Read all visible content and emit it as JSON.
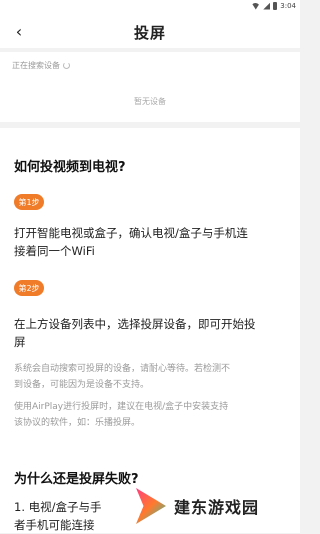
{
  "status_bar": {
    "time": "3:04"
  },
  "header": {
    "title": "投屏",
    "back_icon": "chevron-left-icon"
  },
  "devices": {
    "searching_label": "正在搜索设备",
    "empty_label": "暂无设备"
  },
  "guide": {
    "heading": "如何投视频到电视?",
    "step1_badge": "第1步",
    "step1_text_line1": "打开智能电视或盒子，确认电视/盒子与手机连",
    "step1_text_line2": "接着同一个WiFi",
    "step2_badge": "第2步",
    "step2_text_line1": "在上方设备列表中，选择投屏设备，即可开始投",
    "step2_text_line2": "屏",
    "note1_line1": "系统会自动搜索可投屏的设备，请耐心等待。若检测不",
    "note1_line2": "到设备，可能因为是设备不支持。",
    "note2_line1": "使用AirPlay进行投屏时，建议在电视/盒子中安装支持",
    "note2_line2": "该协议的软件，如：乐播投屏。",
    "fail_heading": "为什么还是投屏失败?",
    "fail_item1_line1": "1. 电视/盒子与手",
    "fail_item1_line2": "者手机可能连接"
  },
  "watermark": {
    "text": "建东游戏园"
  }
}
